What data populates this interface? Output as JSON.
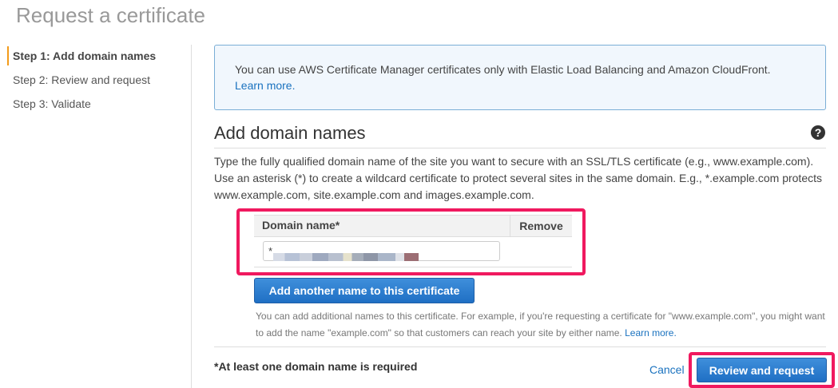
{
  "page": {
    "title": "Request a certificate"
  },
  "steps": [
    {
      "label": "Step 1: Add domain names"
    },
    {
      "label": "Step 2: Review and request"
    },
    {
      "label": "Step 3: Validate"
    }
  ],
  "info": {
    "text": "You can use AWS Certificate Manager certificates only with Elastic Load Balancing and Amazon CloudFront.",
    "link": "Learn more."
  },
  "section": {
    "title": "Add domain names",
    "help_icon": "?",
    "description": "Type the fully qualified domain name of the site you want to secure with an SSL/TLS certificate (e.g., www.example.com). Use an asterisk (*) to create a wildcard certificate to protect several sites in the same domain. E.g., *.example.com protects www.example.com, site.example.com and images.example.com."
  },
  "table": {
    "col_domain": "Domain name*",
    "col_remove": "Remove",
    "domain_value": "*."
  },
  "add_button": "Add another name to this certificate",
  "note": {
    "text": "You can add additional names to this certificate. For example, if you're requesting a certificate for \"www.example.com\", you might want to add the name \"example.com\" so that customers can reach your site by either name.",
    "link": "Learn more."
  },
  "footer": {
    "required": "*At least one domain name is required",
    "cancel": "Cancel",
    "review": "Review and request"
  },
  "colors": {
    "accent": "#1f6fc4",
    "highlight": "#f0195f",
    "active_step": "#f39b1a"
  }
}
